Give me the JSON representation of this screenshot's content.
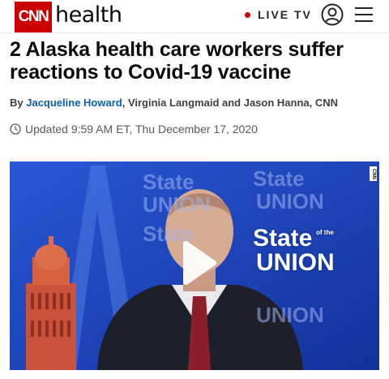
{
  "header": {
    "logo_text": "CNN",
    "section": "health",
    "live_label": "LIVE TV",
    "user_icon": "user-circle-icon",
    "menu_icon": "hamburger-menu-icon",
    "brand_color": "#cc0000"
  },
  "article": {
    "headline": "2 Alaska health care workers suffer reactions to Covid-19 vaccine",
    "byline_prefix": "By ",
    "byline_author_link": "Jacqueline Howard",
    "byline_rest": ", Virginia Langmaid and Jason Hanna, CNN",
    "timestamp": "Updated 9:59 AM ET, Thu December 17, 2020",
    "link_color": "#0c5ea8"
  },
  "video": {
    "bug_text": "CNN",
    "brand_lines": [
      "State",
      "UNION",
      "State",
      "UNION",
      "State",
      "UNION",
      "State",
      "UNION"
    ],
    "brand_small": "of the",
    "play_icon": "play-icon",
    "background_color": "#1a3fb5"
  }
}
